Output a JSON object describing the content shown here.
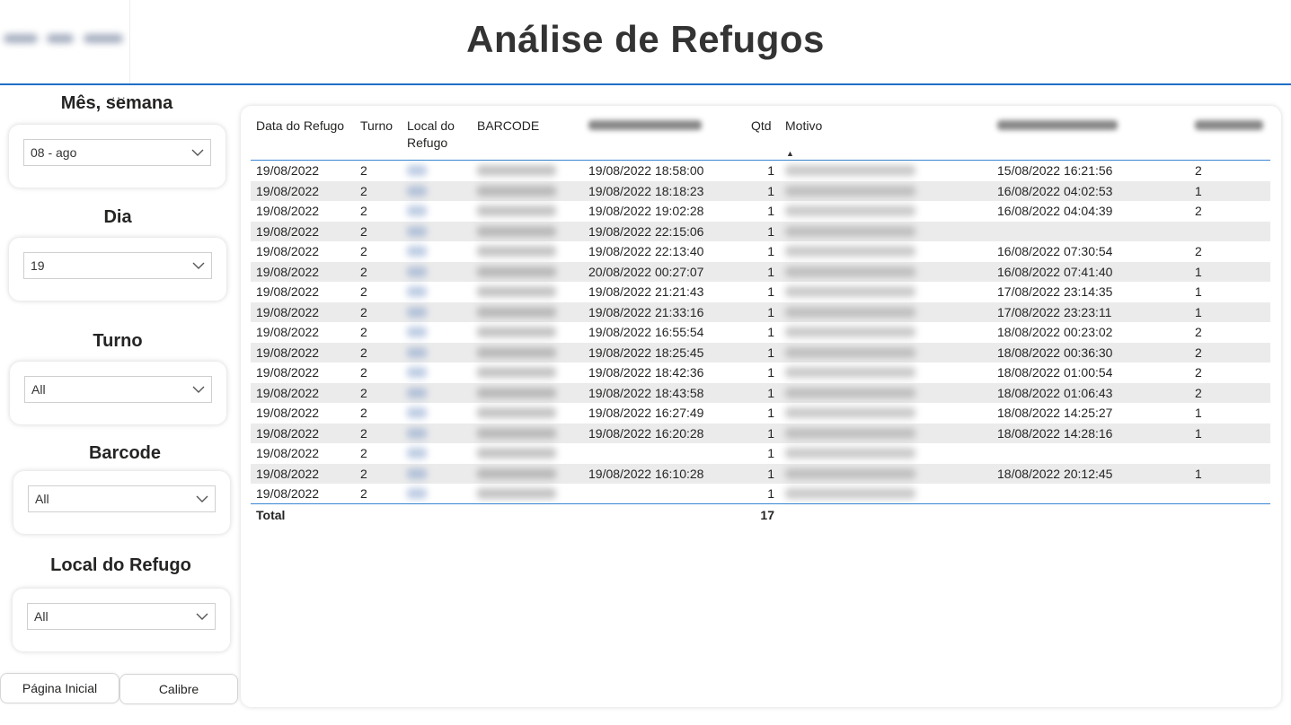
{
  "page": {
    "title": "Análise de Refugos"
  },
  "slicers": {
    "mes_semana": {
      "title": "Mês, semana",
      "value": "08 - ago"
    },
    "dia": {
      "title": "Dia",
      "value": "19"
    },
    "turno": {
      "title": "Turno",
      "value": "All"
    },
    "barcode": {
      "title": "Barcode",
      "value": "All"
    },
    "local": {
      "title": "Local do Refugo",
      "value": "All"
    }
  },
  "nav": {
    "home_label": "Página Inicial",
    "calibre_label": "Calibre"
  },
  "table": {
    "headers": {
      "data": "Data do Refugo",
      "turno": "Turno",
      "local": "Local do Refugo",
      "barcode": "BARCODE",
      "qtd": "Qtd",
      "motivo": "Motivo"
    },
    "rows": [
      {
        "data": "19/08/2022",
        "turno": "2",
        "hora": "19/08/2022 18:58:00",
        "qtd": "1",
        "pick": "15/08/2022 16:21:56",
        "n": "2"
      },
      {
        "data": "19/08/2022",
        "turno": "2",
        "hora": "19/08/2022 18:18:23",
        "qtd": "1",
        "pick": "16/08/2022 04:02:53",
        "n": "1"
      },
      {
        "data": "19/08/2022",
        "turno": "2",
        "hora": "19/08/2022 19:02:28",
        "qtd": "1",
        "pick": "16/08/2022 04:04:39",
        "n": "2"
      },
      {
        "data": "19/08/2022",
        "turno": "2",
        "hora": "19/08/2022 22:15:06",
        "qtd": "1",
        "pick": "",
        "n": ""
      },
      {
        "data": "19/08/2022",
        "turno": "2",
        "hora": "19/08/2022 22:13:40",
        "qtd": "1",
        "pick": "16/08/2022 07:30:54",
        "n": "2"
      },
      {
        "data": "19/08/2022",
        "turno": "2",
        "hora": "20/08/2022 00:27:07",
        "qtd": "1",
        "pick": "16/08/2022 07:41:40",
        "n": "1"
      },
      {
        "data": "19/08/2022",
        "turno": "2",
        "hora": "19/08/2022 21:21:43",
        "qtd": "1",
        "pick": "17/08/2022 23:14:35",
        "n": "1"
      },
      {
        "data": "19/08/2022",
        "turno": "2",
        "hora": "19/08/2022 21:33:16",
        "qtd": "1",
        "pick": "17/08/2022 23:23:11",
        "n": "1"
      },
      {
        "data": "19/08/2022",
        "turno": "2",
        "hora": "19/08/2022 16:55:54",
        "qtd": "1",
        "pick": "18/08/2022 00:23:02",
        "n": "2"
      },
      {
        "data": "19/08/2022",
        "turno": "2",
        "hora": "19/08/2022 18:25:45",
        "qtd": "1",
        "pick": "18/08/2022 00:36:30",
        "n": "2"
      },
      {
        "data": "19/08/2022",
        "turno": "2",
        "hora": "19/08/2022 18:42:36",
        "qtd": "1",
        "pick": "18/08/2022 01:00:54",
        "n": "2"
      },
      {
        "data": "19/08/2022",
        "turno": "2",
        "hora": "19/08/2022 18:43:58",
        "qtd": "1",
        "pick": "18/08/2022 01:06:43",
        "n": "2"
      },
      {
        "data": "19/08/2022",
        "turno": "2",
        "hora": "19/08/2022 16:27:49",
        "qtd": "1",
        "pick": "18/08/2022 14:25:27",
        "n": "1"
      },
      {
        "data": "19/08/2022",
        "turno": "2",
        "hora": "19/08/2022 16:20:28",
        "qtd": "1",
        "pick": "18/08/2022 14:28:16",
        "n": "1"
      },
      {
        "data": "19/08/2022",
        "turno": "2",
        "hora": "",
        "qtd": "1",
        "pick": "",
        "n": ""
      },
      {
        "data": "19/08/2022",
        "turno": "2",
        "hora": "19/08/2022 16:10:28",
        "qtd": "1",
        "pick": "18/08/2022 20:12:45",
        "n": "1"
      },
      {
        "data": "19/08/2022",
        "turno": "2",
        "hora": "",
        "qtd": "1",
        "pick": "",
        "n": ""
      }
    ],
    "total": {
      "label": "Total",
      "qtd": "17"
    }
  },
  "colors": {
    "accent": "#1f6fc5",
    "row_alt": "#ebebeb"
  },
  "icons": {
    "dropdown": "chevron-down-icon",
    "more": "more-options-icon"
  }
}
